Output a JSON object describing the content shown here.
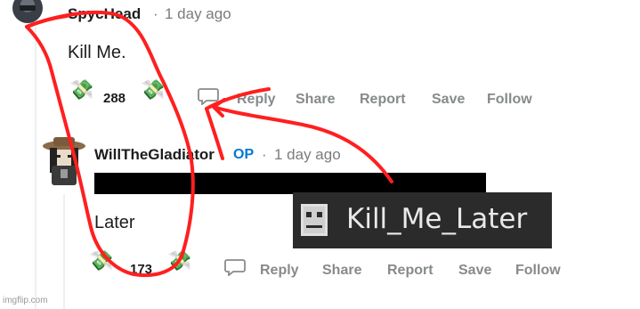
{
  "comment1": {
    "username": "SpycHead",
    "separator": "·",
    "time": "1 day ago",
    "text": "Kill Me.",
    "score": "288",
    "actions": {
      "reply": "Reply",
      "share": "Share",
      "report": "Report",
      "save": "Save",
      "follow": "Follow"
    }
  },
  "comment2": {
    "username": "WillTheGladiator",
    "op_badge": "OP",
    "separator": "·",
    "time": "1 day ago",
    "text": "Later",
    "score": "173",
    "actions": {
      "reply": "Reply",
      "share": "Share",
      "report": "Report",
      "save": "Save",
      "follow": "Follow"
    }
  },
  "overlay": {
    "text": "Kill_Me_Later"
  },
  "watermark": "imgflip.com",
  "icons": {
    "money": "money-with-wings-icon",
    "reply": "chat-bubble-icon"
  },
  "colors": {
    "op": "#0079d3",
    "annotation": "#ff1f1f",
    "muted": "#878a8c"
  }
}
